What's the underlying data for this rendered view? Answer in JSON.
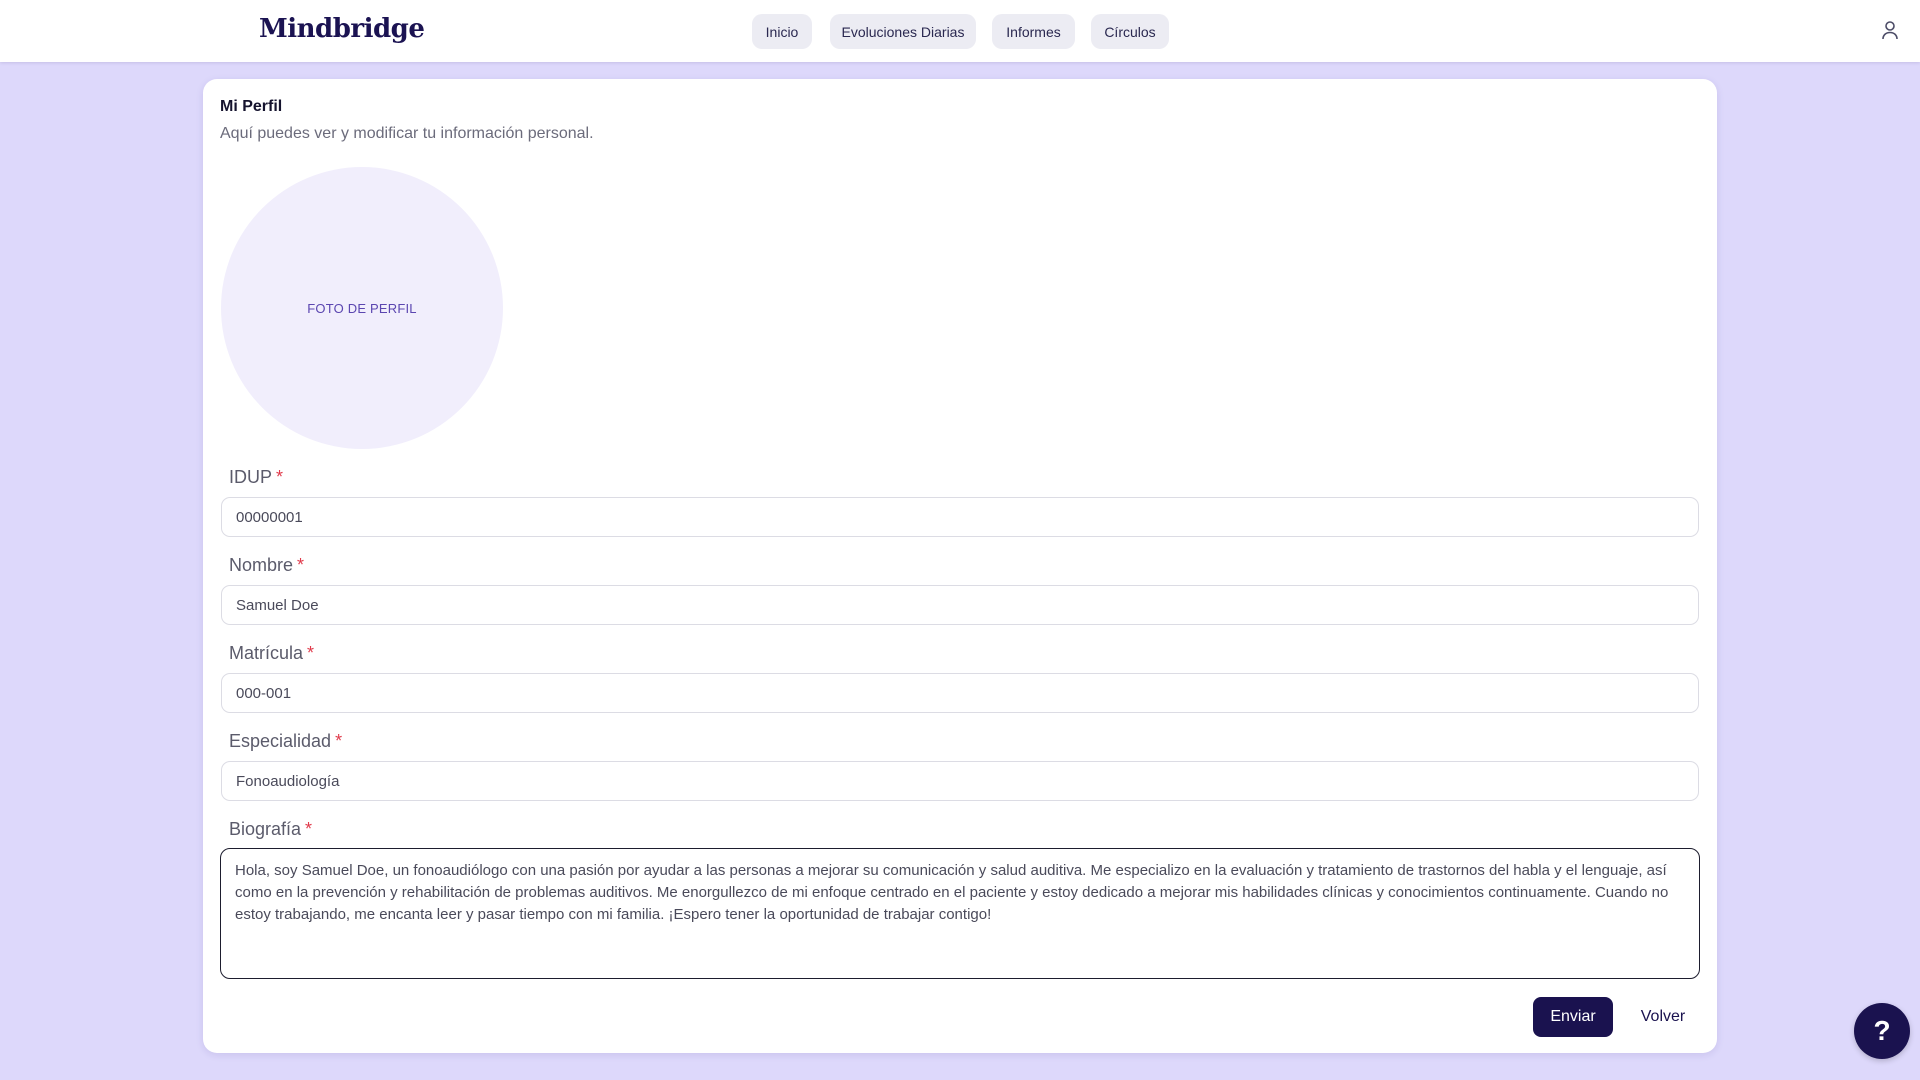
{
  "header": {
    "logo": "Mindbridge",
    "nav": [
      {
        "label": "Inicio"
      },
      {
        "label": "Evoluciones Diarias"
      },
      {
        "label": "Informes"
      },
      {
        "label": "Círculos"
      }
    ],
    "user_icon": "user-icon"
  },
  "profile": {
    "title": "Mi Perfil",
    "subtitle": "Aquí puedes ver y modificar tu información personal.",
    "photo_placeholder": "FOTO DE PERFIL",
    "fields": {
      "idup": {
        "label": "IDUP",
        "required_mark": "*",
        "value": "00000001"
      },
      "nombre": {
        "label": "Nombre",
        "required_mark": "*",
        "value": "Samuel Doe"
      },
      "matricula": {
        "label": "Matrícula",
        "required_mark": "*",
        "value": "000-001"
      },
      "especialidad": {
        "label": "Especialidad",
        "required_mark": "*",
        "value": "Fonoaudiología"
      },
      "biografia": {
        "label": "Biografía",
        "required_mark": "*",
        "value": "Hola, soy Samuel Doe, un fonoaudiólogo con una pasión por ayudar a las personas a mejorar su comunicación y salud auditiva. Me especializo en la evaluación y tratamiento de trastornos del habla y el lenguaje, así como en la prevención y rehabilitación de problemas auditivos. Me enorgullezco de mi enfoque centrado en el paciente y estoy dedicado a mejorar mis habilidades clínicas y conocimientos continuamente. Cuando no estoy trabajando, me encanta leer y pasar tiempo con mi familia. ¡Espero tener la oportunidad de trabajar contigo!"
      }
    },
    "actions": {
      "submit_label": "Enviar",
      "back_label": "Volver"
    }
  },
  "help": {
    "label": "?",
    "icon": "help-icon"
  },
  "colors": {
    "page_background": "#ddd8fb",
    "primary": "#1a124f",
    "required": "#e03a4b",
    "avatar_fill": "#f1eefc"
  }
}
